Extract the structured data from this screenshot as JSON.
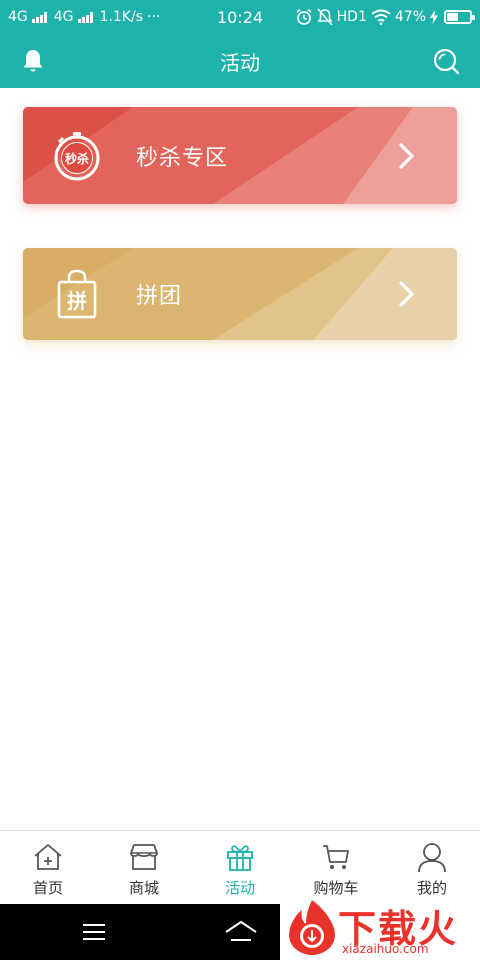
{
  "status": {
    "network1": "4G",
    "network2": "4G",
    "speed": "1.1K/s",
    "more": "···",
    "time": "10:24",
    "hd": "HD1",
    "battery_text": "47%",
    "battery_level": 0.47
  },
  "header": {
    "title": "活动"
  },
  "cards": [
    {
      "label": "秒杀专区",
      "badge": "秒杀",
      "color": "#e2645a"
    },
    {
      "label": "拼团",
      "badge": "拼",
      "color": "#dcb571"
    }
  ],
  "nav": {
    "items": [
      {
        "label": "首页"
      },
      {
        "label": "商城"
      },
      {
        "label": "活动"
      },
      {
        "label": "购物车"
      },
      {
        "label": "我的"
      }
    ],
    "active_color": "#1db3ab"
  },
  "watermark": {
    "brand": "下载火",
    "domain": "xiazaihuo.com"
  },
  "colors": {
    "primary": "#1db3ab"
  }
}
